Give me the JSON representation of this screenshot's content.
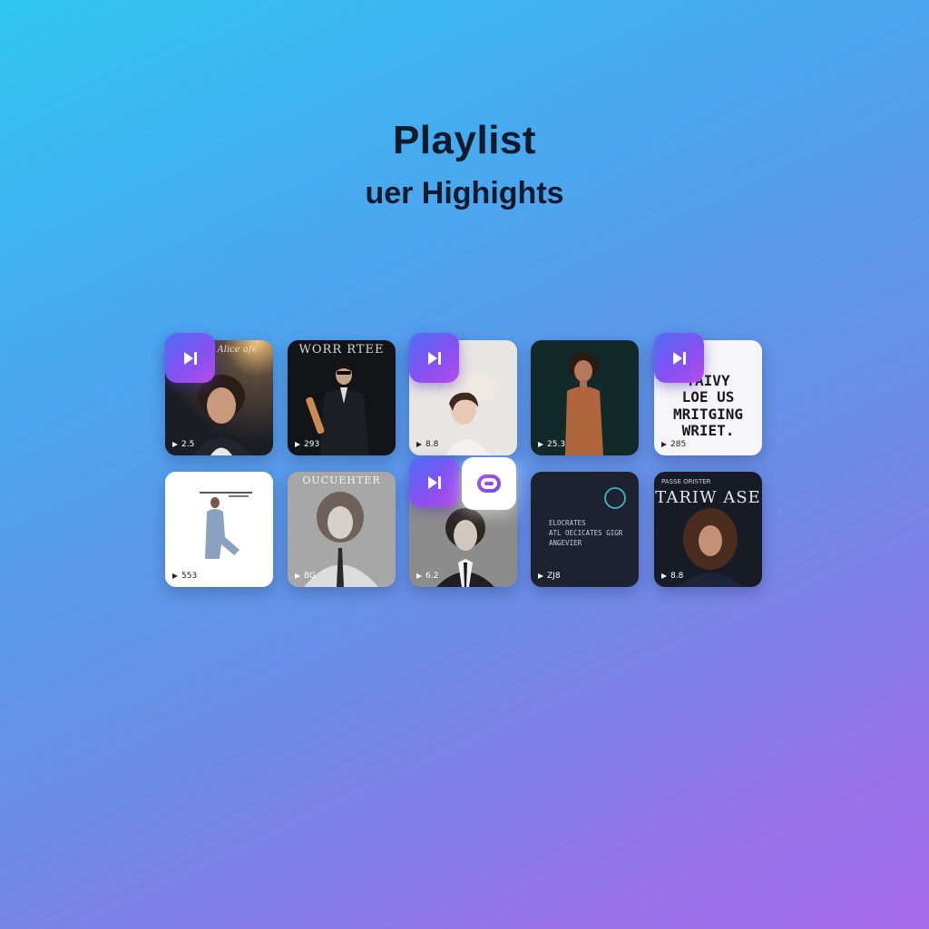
{
  "header": {
    "title": "Playlist",
    "subtitle": "uer Highights"
  },
  "colors": {
    "accent_gradient_start": "#4b6ef6",
    "accent_gradient_end": "#b64fe6",
    "title_color": "#0f1a2e"
  },
  "cards": [
    {
      "art_text": "Alice afe",
      "plays": "2.5"
    },
    {
      "art_text": "WORR RTEE",
      "plays": "293"
    },
    {
      "art_text": "",
      "plays": "8.8"
    },
    {
      "art_text": "",
      "plays": "25.3"
    },
    {
      "art_text": "TAIVY LOE US MRITGING WRIET.",
      "art_lines": [
        "TAIVY",
        "LOE US",
        "MRITGING",
        "WRIET."
      ],
      "plays": "285"
    },
    {
      "art_text": "",
      "plays": "553"
    },
    {
      "art_text": "OUCUEHTER",
      "plays": "BG"
    },
    {
      "art_text": "",
      "plays": "6.2"
    },
    {
      "art_text": "ELOCRATES ATL DECICATES GIGR ANGEVIER",
      "art_lines": [
        "ELOCRATES",
        "ATL OECICATES GIGR",
        "ANGEVIER"
      ],
      "plays": "ZJ8"
    },
    {
      "art_text": "PASSE ORISTER TARIW ASE",
      "art_small": "PASSE ORISTER",
      "art_big": "TARIW ASE",
      "plays": "8.8"
    }
  ],
  "icons": {
    "skip": "skip-next-icon",
    "link": "link-icon",
    "play": "play-icon"
  }
}
